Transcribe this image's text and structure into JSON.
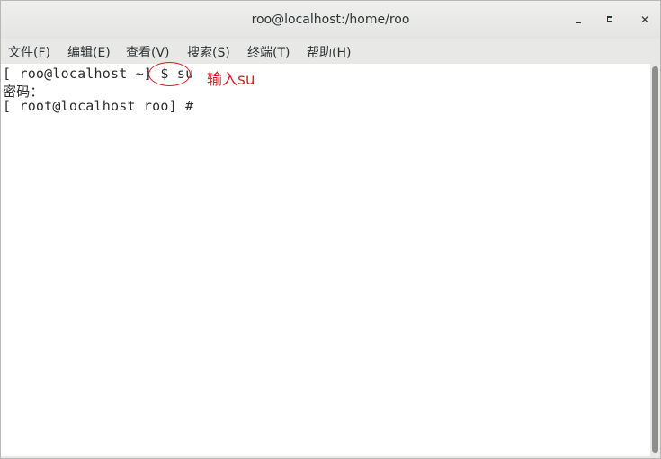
{
  "window": {
    "title": "roo@localhost:/home/roo",
    "controls": {
      "minimize_icon": "minimize-icon",
      "maximize_icon": "maximize-icon",
      "close_icon": "close-icon",
      "close_glyph": "✕"
    }
  },
  "menu": {
    "items": [
      {
        "label": "文件(F)"
      },
      {
        "label": "编辑(E)"
      },
      {
        "label": "查看(V)"
      },
      {
        "label": "搜索(S)"
      },
      {
        "label": "终端(T)"
      },
      {
        "label": "帮助(H)"
      }
    ]
  },
  "terminal": {
    "lines": [
      "[ roo@localhost ~] $ su",
      "密码：",
      "[ root@localhost roo] #"
    ]
  },
  "annotation": {
    "text": "输入su",
    "color": "#e02020"
  }
}
